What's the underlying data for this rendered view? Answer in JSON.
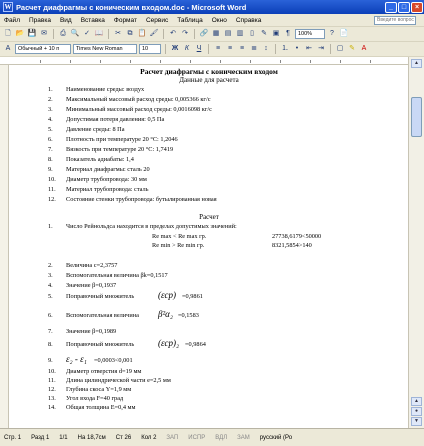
{
  "window": {
    "title": "Расчет диафрагмы с коническим входом.doc - Microsoft Word"
  },
  "menu": [
    "Файл",
    "Правка",
    "Вид",
    "Вставка",
    "Формат",
    "Сервис",
    "Таблица",
    "Окно",
    "Справка"
  ],
  "ask_placeholder": "Введите вопрос",
  "toolbar": {
    "zoom": "100%",
    "style": "Обычный + 10 п",
    "font": "Times New Roman",
    "size": "10"
  },
  "doc": {
    "title": "Расчет диафрагмы с коническим входом",
    "subtitle": "Данные для расчета",
    "inputs": [
      {
        "n": "1.",
        "t": "Наименование среды: воздух"
      },
      {
        "n": "2.",
        "t": "Максимальный массовый расход среды: 0,005366 кг/с"
      },
      {
        "n": "3.",
        "t": "Минимальный массовый расход среды: 0,0016098 кг/с"
      },
      {
        "n": "4.",
        "t": "Допустимая потеря давления: 0,5 Па"
      },
      {
        "n": "5.",
        "t": "Давление среды: 8 Па"
      },
      {
        "n": "6.",
        "t": "Плотность при температуре 20 °С: 1,2046"
      },
      {
        "n": "7.",
        "t": "Вязкость при температуре 20 °С: 1,7419"
      },
      {
        "n": "8.",
        "t": "Показатель адиабаты: 1,4"
      },
      {
        "n": "9.",
        "t": "Материал диафрагмы: сталь 20"
      },
      {
        "n": "10.",
        "t": "Диаметр трубопровода: 30 мм"
      },
      {
        "n": "11.",
        "t": "Материал трубопровода: сталь"
      },
      {
        "n": "12.",
        "t": "Состояние стенки трубопровода: бутылированная новая"
      }
    ],
    "calc_title": "Расчет",
    "calc1": "Число Рейнольдса находится в пределах допустимых значений:",
    "re1_label": "Re max < Re max гр.",
    "re1_val": "27738,6179<50000",
    "re2_label": "Re min > Re min гр.",
    "re2_val": "8321,5854>140",
    "calc": [
      {
        "n": "2.",
        "t": "Величина c=2,3757"
      },
      {
        "n": "3.",
        "t": "Вспомогательная величина βk=0,1517"
      },
      {
        "n": "4.",
        "t": "Значение β=0,1937"
      },
      {
        "n": "5.",
        "t": "Поправочный множитель",
        "f": "(εcp)",
        "v": "=0,9861"
      },
      {
        "n": "6.",
        "t": "Вспомогательная величина",
        "f": "β²α₂",
        "v": "=0,1583"
      },
      {
        "n": "7.",
        "t": "Значение β=0,1989"
      },
      {
        "n": "8.",
        "t": "Поправочный множитель",
        "f": "(εcp)₂",
        "v": "=0,9864"
      },
      {
        "n": "9.",
        "t": "",
        "f": "ε₂ - ε₁",
        "v": "=0,0003<0,001"
      },
      {
        "n": "10.",
        "t": "Диаметр отверстия d=19 мм"
      },
      {
        "n": "11.",
        "t": "Длина цилиндрической части e=2,5 мм"
      },
      {
        "n": "12.",
        "t": "Глубина скоса Y=1,9 мм"
      },
      {
        "n": "13.",
        "t": "Угол входа F=40 град"
      },
      {
        "n": "14.",
        "t": "Общая толщина E=0,4 мм"
      }
    ]
  },
  "status": {
    "page": "Стр. 1",
    "section": "Разд 1",
    "pages": "1/1",
    "at": "На 18,7см",
    "line": "Ст 26",
    "col": "Кол 2",
    "rec": "ЗАП",
    "isp": "ИСПР",
    "vdl": "ВДЛ",
    "zam": "ЗАМ",
    "lang": "русский (Ро"
  }
}
